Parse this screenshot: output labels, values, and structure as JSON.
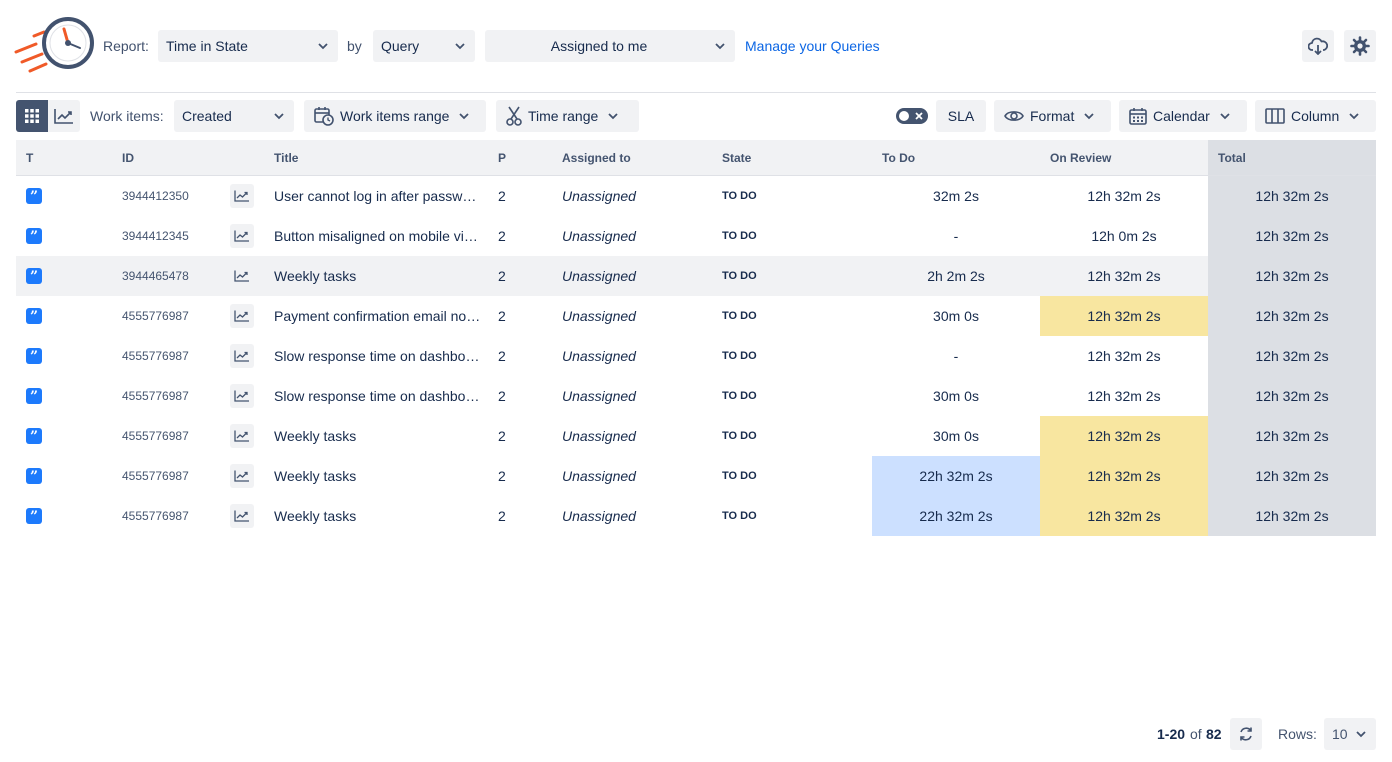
{
  "header": {
    "report_label": "Report:",
    "report_value": "Time in State",
    "by_label": "by",
    "by_value": "Query",
    "query_value": "Assigned to me",
    "manage_link": "Manage your Queries",
    "icons": {
      "export": "cloud-download-icon",
      "settings": "gear-icon"
    }
  },
  "toolbar": {
    "view_grid_icon": "grid-icon",
    "view_chart_icon": "chart-icon",
    "work_items_label": "Work items:",
    "work_items_value": "Created",
    "work_items_range": "Work items range",
    "time_range": "Time range",
    "sla_label": "SLA",
    "format_label": "Format",
    "calendar_label": "Calendar",
    "column_label": "Column"
  },
  "table": {
    "columns": [
      "T",
      "ID",
      "Title",
      "P",
      "Assigned to",
      "State",
      "To Do",
      "On Review",
      "Total"
    ],
    "rows": [
      {
        "id": "3944412350",
        "title": "User cannot log in after passw…",
        "p": "2",
        "assigned": "Unassigned",
        "state": "TO DO",
        "todo": "32m 2s",
        "review": "12h 32m 2s",
        "total": "12h 32m 2s"
      },
      {
        "id": "3944412345",
        "title": "Button misaligned on mobile vi…",
        "p": "2",
        "assigned": "Unassigned",
        "state": "TO DO",
        "todo": "-",
        "review": "12h 0m 2s",
        "total": "12h 32m 2s"
      },
      {
        "id": "3944465478",
        "title": "Weekly tasks",
        "p": "2",
        "assigned": "Unassigned",
        "state": "TO DO",
        "todo": "2h 2m 2s",
        "review": "12h 32m 2s",
        "total": "12h 32m 2s"
      },
      {
        "id": "4555776987",
        "title": "Payment confirmation email no…",
        "p": "2",
        "assigned": "Unassigned",
        "state": "TO DO",
        "todo": "30m 0s",
        "review": "12h 32m 2s",
        "total": "12h 32m 2s"
      },
      {
        "id": "4555776987",
        "title": "Slow response time on dashbo…",
        "p": "2",
        "assigned": "Unassigned",
        "state": "TO DO",
        "todo": "-",
        "review": "12h 32m 2s",
        "total": "12h 32m 2s"
      },
      {
        "id": "4555776987",
        "title": "Slow response time on dashbo…",
        "p": "2",
        "assigned": "Unassigned",
        "state": "TO DO",
        "todo": "30m 0s",
        "review": "12h 32m 2s",
        "total": "12h 32m 2s"
      },
      {
        "id": "4555776987",
        "title": "Weekly tasks",
        "p": "2",
        "assigned": "Unassigned",
        "state": "TO DO",
        "todo": "30m 0s",
        "review": "12h 32m 2s",
        "total": "12h 32m 2s"
      },
      {
        "id": "4555776987",
        "title": "Weekly tasks",
        "p": "2",
        "assigned": "Unassigned",
        "state": "TO DO",
        "todo": "22h 32m 2s",
        "review": "12h 32m 2s",
        "total": "12h 32m 2s"
      },
      {
        "id": "4555776987",
        "title": "Weekly tasks",
        "p": "2",
        "assigned": "Unassigned",
        "state": "TO DO",
        "todo": "22h 32m 2s",
        "review": "12h 32m 2s",
        "total": "12h 32m 2s"
      }
    ]
  },
  "footer": {
    "range": "1-20",
    "of_label": "of",
    "total": "82",
    "rows_label": "Rows:",
    "rows_value": "10"
  },
  "colors": {
    "accent": "#1d7afc",
    "hover_row": "#f1f2f4",
    "sla_warning": "#f8e6a0",
    "sla_highlight": "#cce0ff",
    "total_column": "#dcdfe4"
  }
}
